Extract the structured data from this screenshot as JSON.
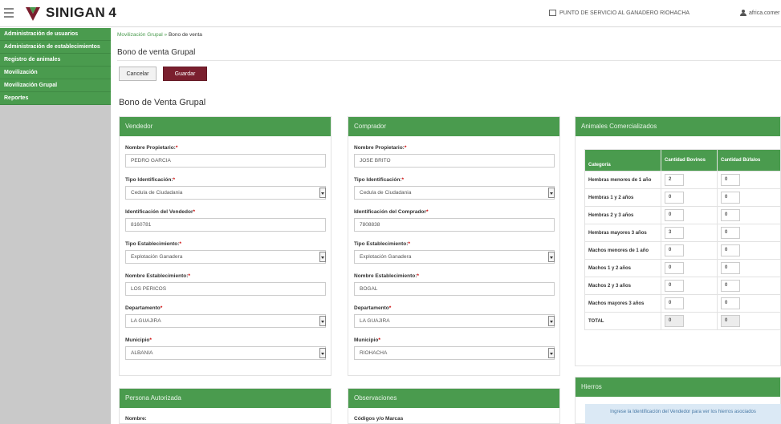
{
  "app": {
    "brand": "SINIGAN",
    "version": "4",
    "service_point": "PUNTO DE SERVICIO AL GANADERO RIOHACHA",
    "user": "africa.comer"
  },
  "sidebar": {
    "items": [
      {
        "label": "Administración de usuarios"
      },
      {
        "label": "Administración de establecimientos"
      },
      {
        "label": "Registro de animales"
      },
      {
        "label": "Movilización"
      },
      {
        "label": "Movilización Grupal"
      },
      {
        "label": "Reportes"
      }
    ]
  },
  "breadcrumb": {
    "parent": "Movilización Grupal",
    "sep": " » ",
    "current": "Bono de venta"
  },
  "page": {
    "title": "Bono de venta Grupal",
    "cancel_label": "Cancelar",
    "save_label": "Guardar",
    "section_title": "Bono de Venta Grupal"
  },
  "vendedor": {
    "header": "Vendedor",
    "fields": {
      "owner": {
        "label": "Nombre Propietario:",
        "value": "PEDRO GARCIA"
      },
      "id_type": {
        "label": "Tipo Identificación:",
        "value": "Cedula de Ciudadania"
      },
      "id_number": {
        "label": "Identificación del Vendedor",
        "value": "8160781"
      },
      "est_type": {
        "label": "Tipo Establecimiento:",
        "value": "Explotación Ganadera"
      },
      "est_name": {
        "label": "Nombre Establecimiento:",
        "value": "LOS PERICOS"
      },
      "department": {
        "label": "Departamento",
        "value": "LA GUAJIRA"
      },
      "municipality": {
        "label": "Municipio",
        "value": "ALBANIA"
      }
    }
  },
  "comprador": {
    "header": "Comprador",
    "fields": {
      "owner": {
        "label": "Nombre Propietario:",
        "value": "JOSE BRITO"
      },
      "id_type": {
        "label": "Tipo Identificación:",
        "value": "Cedula de Ciudadania"
      },
      "id_number": {
        "label": "Identificación del Comprador",
        "value": "7808838"
      },
      "est_type": {
        "label": "Tipo Establecimiento:",
        "value": "Explotación Ganadera"
      },
      "est_name": {
        "label": "Nombre Establecimiento:",
        "value": "BOGAL"
      },
      "department": {
        "label": "Departamento",
        "value": "LA GUAJIRA"
      },
      "municipality": {
        "label": "Municipio",
        "value": "RIOHACHA"
      }
    }
  },
  "animales": {
    "header": "Animales Comercializados",
    "columns": [
      "Categoría",
      "Cantidad Bovinos",
      "Cantidad Búfalos"
    ],
    "rows": [
      {
        "category": "Hembras menores de 1 año",
        "bovinos": "2",
        "bufalos": "0"
      },
      {
        "category": "Hembras 1 y 2 años",
        "bovinos": "0",
        "bufalos": "0"
      },
      {
        "category": "Hembras 2 y 3 años",
        "bovinos": "0",
        "bufalos": "0"
      },
      {
        "category": "Hembras mayores 3 años",
        "bovinos": "3",
        "bufalos": "0"
      },
      {
        "category": "Machos menores de 1 año",
        "bovinos": "0",
        "bufalos": "0"
      },
      {
        "category": "Machos 1 y 2 años",
        "bovinos": "0",
        "bufalos": "0"
      },
      {
        "category": "Machos 2 y 3 años",
        "bovinos": "0",
        "bufalos": "0"
      },
      {
        "category": "Machos mayores 3 años",
        "bovinos": "0",
        "bufalos": "0"
      },
      {
        "category": "TOTAL",
        "bovinos": "0",
        "bufalos": "0"
      }
    ]
  },
  "persona": {
    "header": "Persona Autorizada",
    "first_label": "Nombre:"
  },
  "observaciones": {
    "header": "Observaciones",
    "first_label": "Códigos y/o Marcas"
  },
  "hierros": {
    "header": "Hierros",
    "hint": "Ingrese la Identificación del Vendedor para ver los hierros asociados"
  },
  "colors": {
    "green": "#4a9b4e",
    "save": "#7a1f2e",
    "sidebar_bg": "#c9c9c9"
  }
}
